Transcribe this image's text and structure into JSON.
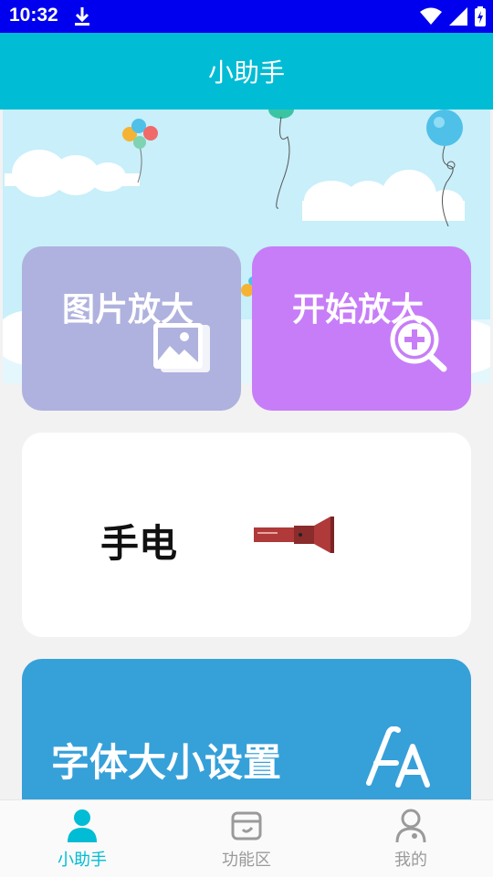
{
  "status_bar": {
    "time": "10:32"
  },
  "app_bar": {
    "title": "小助手"
  },
  "cards": {
    "image_zoom": {
      "label": "图片放大",
      "color": "#afb2de"
    },
    "start_zoom": {
      "label": "开始放大",
      "color": "#c77df7"
    },
    "flashlight": {
      "label": "手电"
    },
    "font_size": {
      "label": "字体大小设置",
      "color": "#36a0d9"
    }
  },
  "bottom_nav": {
    "items": [
      {
        "label": "小助手",
        "active": true
      },
      {
        "label": "功能区",
        "active": false
      },
      {
        "label": "我的",
        "active": false
      }
    ],
    "active_color": "#00bcd4",
    "inactive_color": "#9a9a9a"
  }
}
